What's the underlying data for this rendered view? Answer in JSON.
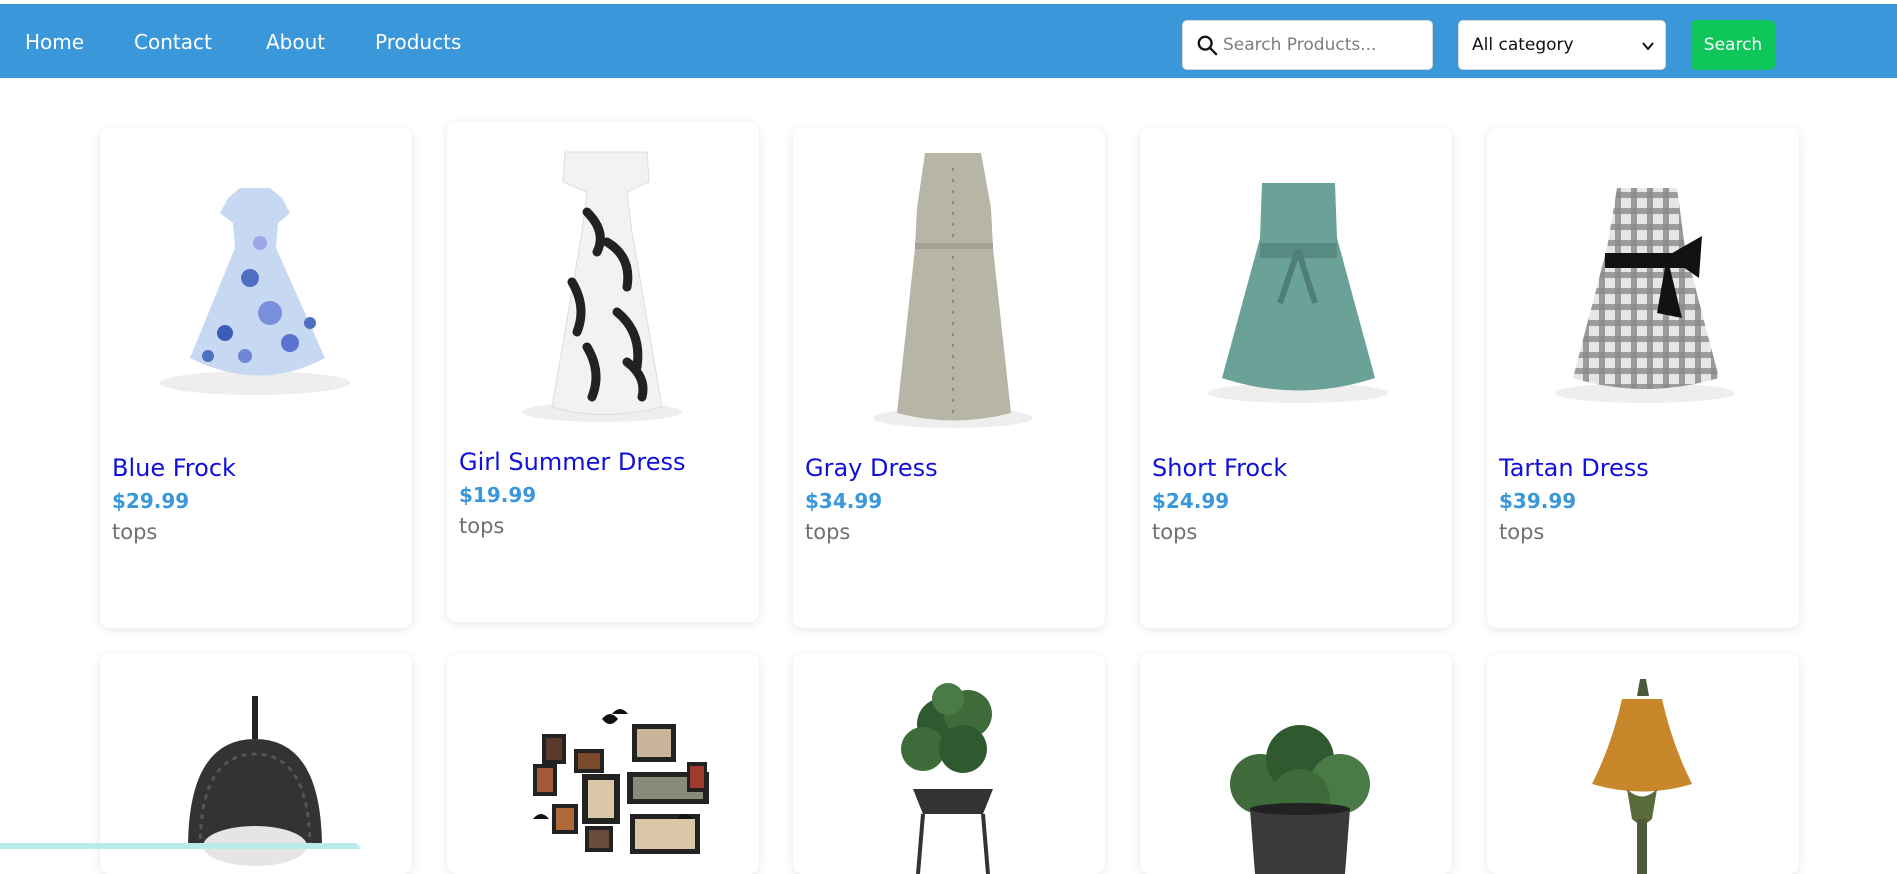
{
  "nav": {
    "links": [
      "Home",
      "Contact",
      "About",
      "Products"
    ]
  },
  "search": {
    "placeholder": "Search Products...",
    "value": ""
  },
  "category_select": {
    "selected": "All category"
  },
  "search_button": {
    "label": "Search"
  },
  "products_row1": [
    {
      "name": "Blue Frock",
      "price": "$29.99",
      "category": "tops",
      "icon": "dress-icon"
    },
    {
      "name": "Girl Summer Dress",
      "price": "$19.99",
      "category": "tops",
      "icon": "dress-icon"
    },
    {
      "name": "Gray Dress",
      "price": "$34.99",
      "category": "tops",
      "icon": "dress-icon"
    },
    {
      "name": "Short Frock",
      "price": "$24.99",
      "category": "tops",
      "icon": "dress-icon"
    },
    {
      "name": "Tartan Dress",
      "price": "$39.99",
      "category": "tops",
      "icon": "dress-icon"
    }
  ],
  "products_row2_icons": [
    "hanging-chair-icon",
    "photo-frames-icon",
    "potted-plant-icon",
    "plant-pot-icon",
    "table-lamp-icon"
  ],
  "colors": {
    "header": "#3a97da",
    "product_name": "#1010d8",
    "price": "#3a97da",
    "search_button": "#0ec65a"
  }
}
